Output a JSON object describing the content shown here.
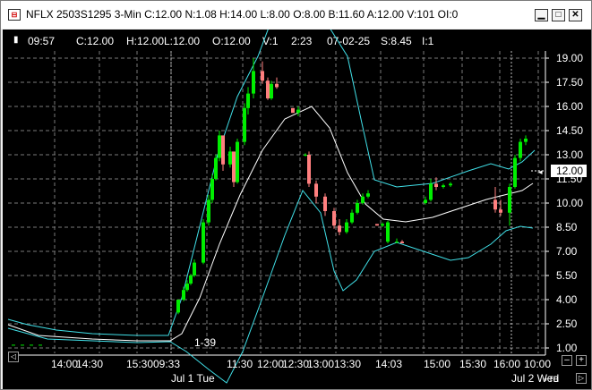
{
  "window": {
    "title": "NFLX 2503S1295 3-Min C:12.00 N:1.08 H:14.00 L:8.00 O:8.00 B:11.60 A:12.00 V:101 OI:0",
    "icon_text": "⊟",
    "minimize_icon": "minimize-icon",
    "maximize_icon": "maximize-icon",
    "close_icon": "close-icon"
  },
  "infobar": {
    "marker": "▮",
    "time": "09:57",
    "close": "C:12.00",
    "high": "H:12.00",
    "low": "L:12.00",
    "open": "O:12.00",
    "volume": "V:1",
    "elapsed": "2:23",
    "date": "07-02-25",
    "strike": "S:8.45",
    "i": "I:1"
  },
  "y_axis_labels": [
    "19.00",
    "17.50",
    "16.00",
    "14.50",
    "13.00",
    "11.50",
    "10.00",
    "8.50",
    "7.00",
    "5.50",
    "4.00",
    "2.50",
    "1.00"
  ],
  "current_price": "12.00",
  "cursor_label": "1-39",
  "x_axis_labels": [
    "14:00",
    "14:30",
    "15:30",
    "09:33",
    "11:30",
    "12:00",
    "12:30",
    "13:00",
    "13:30",
    "14:03",
    "15:00",
    "15:30",
    "16:00",
    "10:00"
  ],
  "day_labels": [
    "Jul 1 Tue",
    "Jul 2 Wed"
  ],
  "controls": {
    "zoom_in": "+",
    "zoom_out": "–",
    "tb": "+TB",
    "nav_left": "◁",
    "nav_right": "▷"
  },
  "colors": {
    "up": "#00ee00",
    "down": "#ff7f7f",
    "band": "#40e0e8",
    "mid": "#ffffff",
    "grid": "#7a7a7a",
    "background": "#000000"
  },
  "chart_data": {
    "type": "candlestick",
    "ylim": [
      1.0,
      19.5
    ],
    "yticks": [
      19.0,
      17.5,
      16.0,
      14.5,
      13.0,
      11.5,
      10.0,
      8.5,
      7.0,
      5.5,
      4.0,
      2.5,
      1.0
    ],
    "grid": true,
    "indicators": [
      "bollinger upper band",
      "bollinger middle (moving average)",
      "bollinger lower band"
    ],
    "candles": [
      [
        1.2,
        1.2,
        1.2,
        1.2
      ],
      [
        1.2,
        1.2,
        1.2,
        1.2
      ],
      [
        1.2,
        1.2,
        1.2,
        1.2
      ],
      [
        1.2,
        1.2,
        1.2,
        1.2
      ],
      [
        3.2,
        4.0,
        3.1,
        4.0
      ],
      [
        4.0,
        4.8,
        3.9,
        4.6
      ],
      [
        4.6,
        5.2,
        4.5,
        5.0
      ],
      [
        5.0,
        5.6,
        4.9,
        5.5
      ],
      [
        5.5,
        6.5,
        5.4,
        6.3
      ],
      [
        6.3,
        9.0,
        6.2,
        8.8
      ],
      [
        8.8,
        10.5,
        8.6,
        10.2
      ],
      [
        10.2,
        11.8,
        10.0,
        11.5
      ],
      [
        11.5,
        13.0,
        11.4,
        12.8
      ],
      [
        12.8,
        14.5,
        12.6,
        14.2
      ],
      [
        14.2,
        13.8,
        12.0,
        12.4
      ],
      [
        12.4,
        13.5,
        12.2,
        13.2
      ],
      [
        13.2,
        12.8,
        11.0,
        11.3
      ],
      [
        11.3,
        14.0,
        11.2,
        13.8
      ],
      [
        13.8,
        16.2,
        13.6,
        15.9
      ],
      [
        15.9,
        17.2,
        15.5,
        16.8
      ],
      [
        16.8,
        19.0,
        16.5,
        18.2
      ],
      [
        18.2,
        18.8,
        17.4,
        17.6
      ],
      [
        17.6,
        17.8,
        16.4,
        16.5
      ],
      [
        16.5,
        17.6,
        16.4,
        17.4
      ],
      [
        17.4,
        17.8,
        17.1,
        17.2
      ],
      [
        15.9,
        15.9,
        15.6,
        15.6
      ],
      [
        15.6,
        16.0,
        15.4,
        15.8
      ],
      [
        13.0,
        13.1,
        12.9,
        13.0
      ],
      [
        13.0,
        13.2,
        11.0,
        11.2
      ],
      [
        11.2,
        11.4,
        10.0,
        10.4
      ],
      [
        10.4,
        10.6,
        9.2,
        9.5
      ],
      [
        9.5,
        9.7,
        8.4,
        8.6
      ],
      [
        8.6,
        9.0,
        8.0,
        8.2
      ],
      [
        8.2,
        9.0,
        8.1,
        8.8
      ],
      [
        8.8,
        9.6,
        8.7,
        9.4
      ],
      [
        9.4,
        10.2,
        9.3,
        10.0
      ],
      [
        10.0,
        10.6,
        9.9,
        10.4
      ],
      [
        10.4,
        10.8,
        10.3,
        10.6
      ],
      [
        8.7,
        8.7,
        8.6,
        8.6
      ],
      [
        8.6,
        8.8,
        8.5,
        8.7
      ],
      [
        7.6,
        8.9,
        7.5,
        8.8
      ],
      [
        7.6,
        7.8,
        7.5,
        7.6
      ],
      [
        7.6,
        7.7,
        7.5,
        7.5
      ],
      [
        10.0,
        10.4,
        9.9,
        10.2
      ],
      [
        10.2,
        11.5,
        10.1,
        11.2
      ],
      [
        11.2,
        11.6,
        10.8,
        11.0
      ],
      [
        11.0,
        11.2,
        10.9,
        11.1
      ],
      [
        11.1,
        11.3,
        11.0,
        11.2
      ],
      [
        10.2,
        11.0,
        9.4,
        9.6
      ],
      [
        9.6,
        10.2,
        9.2,
        9.4
      ],
      [
        9.4,
        11.2,
        8.6,
        11.0
      ],
      [
        11.0,
        13.0,
        10.9,
        12.8
      ],
      [
        12.8,
        14.0,
        12.6,
        13.8
      ],
      [
        13.8,
        14.2,
        13.6,
        14.0
      ]
    ]
  }
}
